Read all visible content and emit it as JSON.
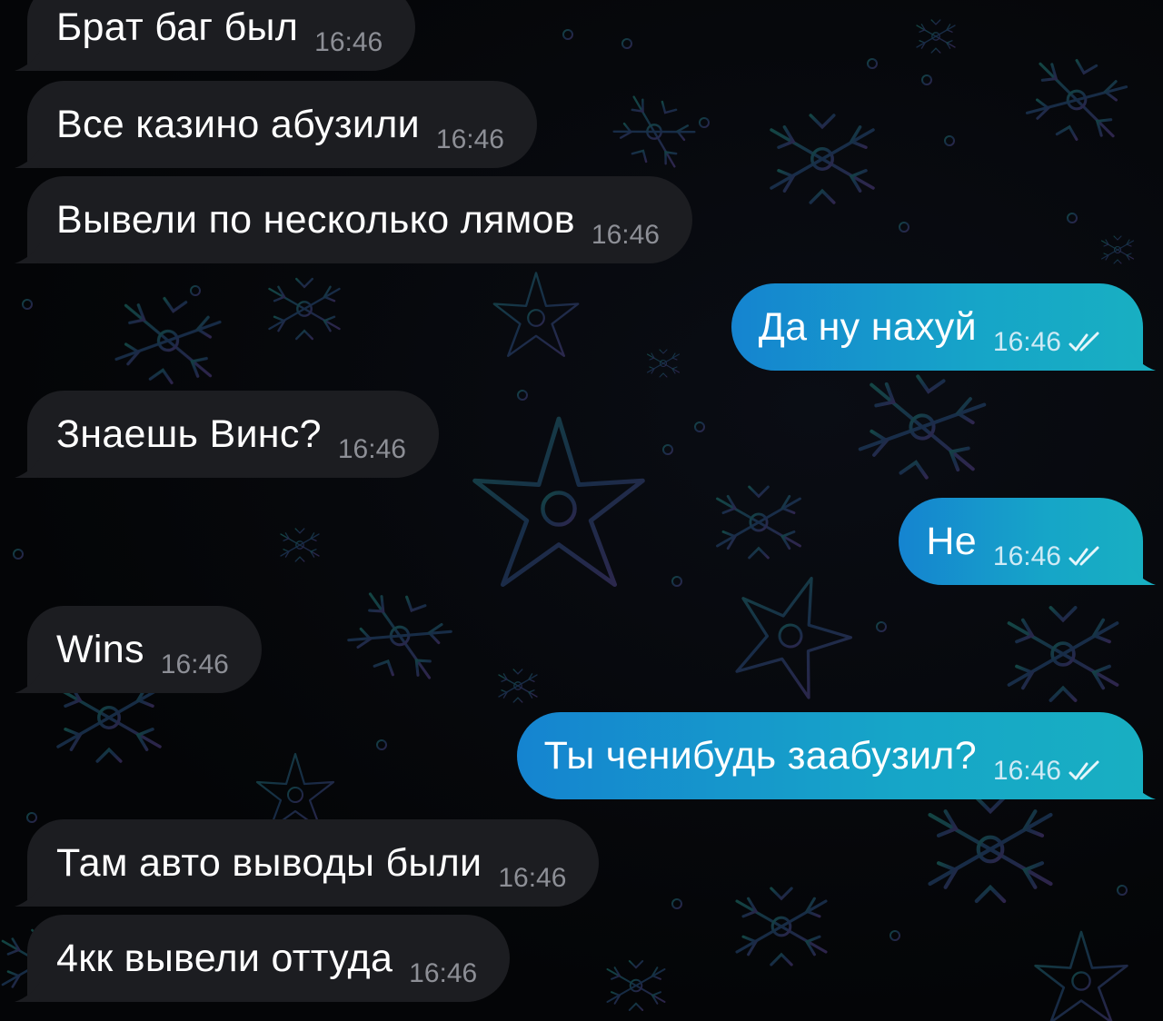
{
  "chat": {
    "messages": [
      {
        "dir": "in",
        "text": "Брат баг был",
        "time": "16:46",
        "read_icon": null
      },
      {
        "dir": "in",
        "text": "Все казино абузили",
        "time": "16:46",
        "read_icon": null
      },
      {
        "dir": "in",
        "text": "Вывели по несколько лямов",
        "time": "16:46",
        "read_icon": null
      },
      {
        "dir": "out",
        "text": "Да ну нахуй",
        "time": "16:46",
        "read_icon": "double-check-icon"
      },
      {
        "dir": "in",
        "text": "Знаешь Винс?",
        "time": "16:46",
        "read_icon": null
      },
      {
        "dir": "out",
        "text": "Не",
        "time": "16:46",
        "read_icon": "double-check-icon"
      },
      {
        "dir": "in",
        "text": "Wins",
        "time": "16:46",
        "read_icon": null
      },
      {
        "dir": "out",
        "text": "Ты ченибудь заабузил?",
        "time": "16:46",
        "read_icon": "double-check-icon"
      },
      {
        "dir": "in",
        "text": "Там авто выводы были",
        "time": "16:46",
        "read_icon": null
      },
      {
        "dir": "in",
        "text": "4кк вывели оттуда",
        "time": "16:46",
        "read_icon": null
      }
    ]
  },
  "colors": {
    "background": "#050607",
    "incoming_bubble": "#1c1d21",
    "outgoing_bubble_start": "#1584d0",
    "outgoing_bubble_end": "#18afc2",
    "wallpaper_pattern": "snowflakes"
  }
}
